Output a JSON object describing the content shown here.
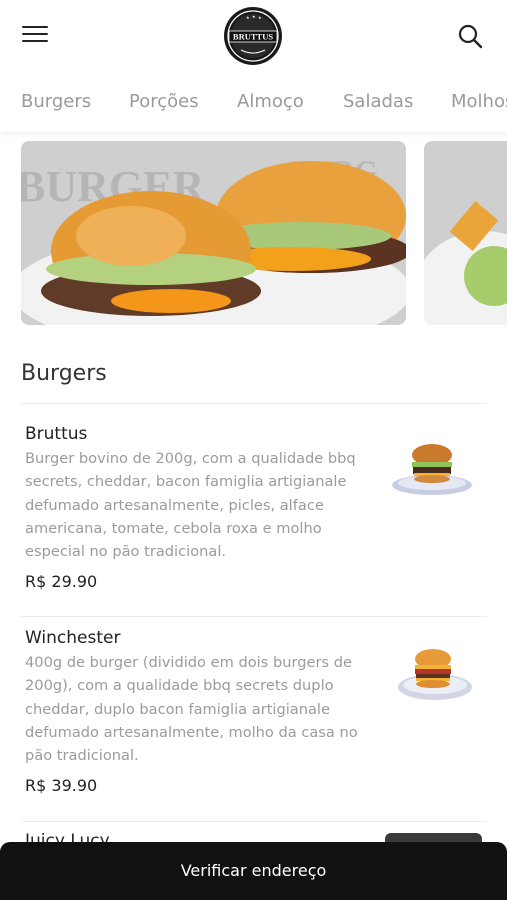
{
  "header": {
    "logo_text": "BRUTTUS",
    "menu_icon": "hamburger-menu-icon",
    "search_icon": "search-icon"
  },
  "categories": [
    "Burgers",
    "Porções",
    "Almoço",
    "Saladas",
    "Molhos"
  ],
  "section": {
    "title": "Burgers"
  },
  "items": [
    {
      "name": "Bruttus",
      "description": "Burger bovino de 200g, com a qualidade bbq secrets, cheddar, bacon famiglia artigianale defumado artesanalmente, picles, alface americana, tomate, cebola roxa e molho especial no pão tradicional.",
      "price": "R$ 29.90"
    },
    {
      "name": "Winchester",
      "description": "400g de burger (dividido em dois burgers de 200g), com a qualidade bbq secrets duplo cheddar, duplo bacon famiglia artigianale defumado artesanalmente, molho da casa no pão tradicional.",
      "price": "R$ 39.90"
    },
    {
      "name": "Juicy Lucy"
    }
  ],
  "bottom_bar": {
    "label": "Verificar endereço"
  },
  "colors": {
    "accent": "#111111",
    "muted_text": "#9b9b9b",
    "text": "#222222"
  }
}
